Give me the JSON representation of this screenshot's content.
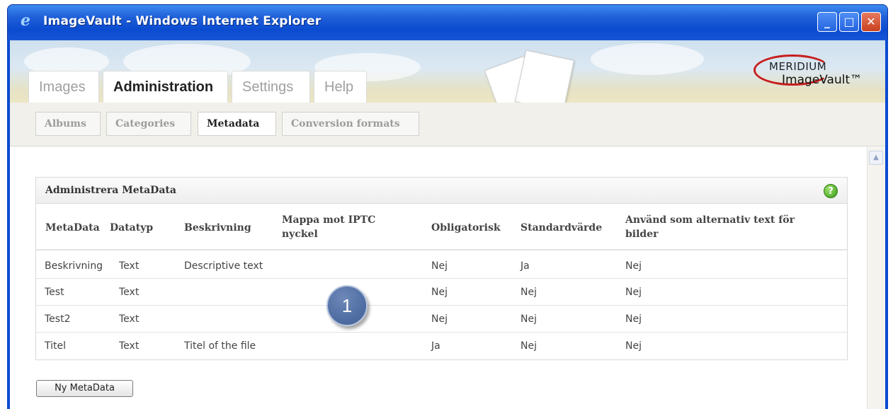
{
  "window": {
    "title": "ImageVault - Windows Internet Explorer",
    "icon": "ie-icon",
    "controls": [
      "minimize",
      "maximize",
      "close"
    ]
  },
  "brand": {
    "company": "MERIDIUM",
    "product": "ImageVault™"
  },
  "main_tabs": [
    {
      "label": "Images",
      "active": false
    },
    {
      "label": "Administration",
      "active": true
    },
    {
      "label": "Settings",
      "active": false
    },
    {
      "label": "Help",
      "active": false
    }
  ],
  "sub_tabs": [
    {
      "label": "Albums",
      "active": false
    },
    {
      "label": "Categories",
      "active": false
    },
    {
      "label": "Metadata",
      "active": true
    },
    {
      "label": "Conversion formats",
      "active": false
    }
  ],
  "panel": {
    "title": "Administrera MetaData",
    "help_icon": "help-icon",
    "columns": [
      "MetaData",
      "Datatyp",
      "Beskrivning",
      "Mappa mot IPTC nyckel",
      "Obligatorisk",
      "Standardvärde",
      "Använd som alternativ text för bilder"
    ],
    "rows": [
      [
        "Beskrivning",
        "Text",
        "Descriptive text",
        "",
        "Nej",
        "Ja",
        "Nej"
      ],
      [
        "Test",
        "Text",
        "",
        "",
        "Nej",
        "Nej",
        "Nej"
      ],
      [
        "Test2",
        "Text",
        "",
        "",
        "Nej",
        "Nej",
        "Nej"
      ],
      [
        "Titel",
        "Text",
        "Titel of the file",
        "",
        "Ja",
        "Nej",
        "Nej"
      ]
    ]
  },
  "callout_badge": "1",
  "new_button_label": "Ny MetaData",
  "colors": {
    "titlebar": "#0b4bd0",
    "badge": "#4d6aa3",
    "help_icon": "#3a9a1a"
  }
}
